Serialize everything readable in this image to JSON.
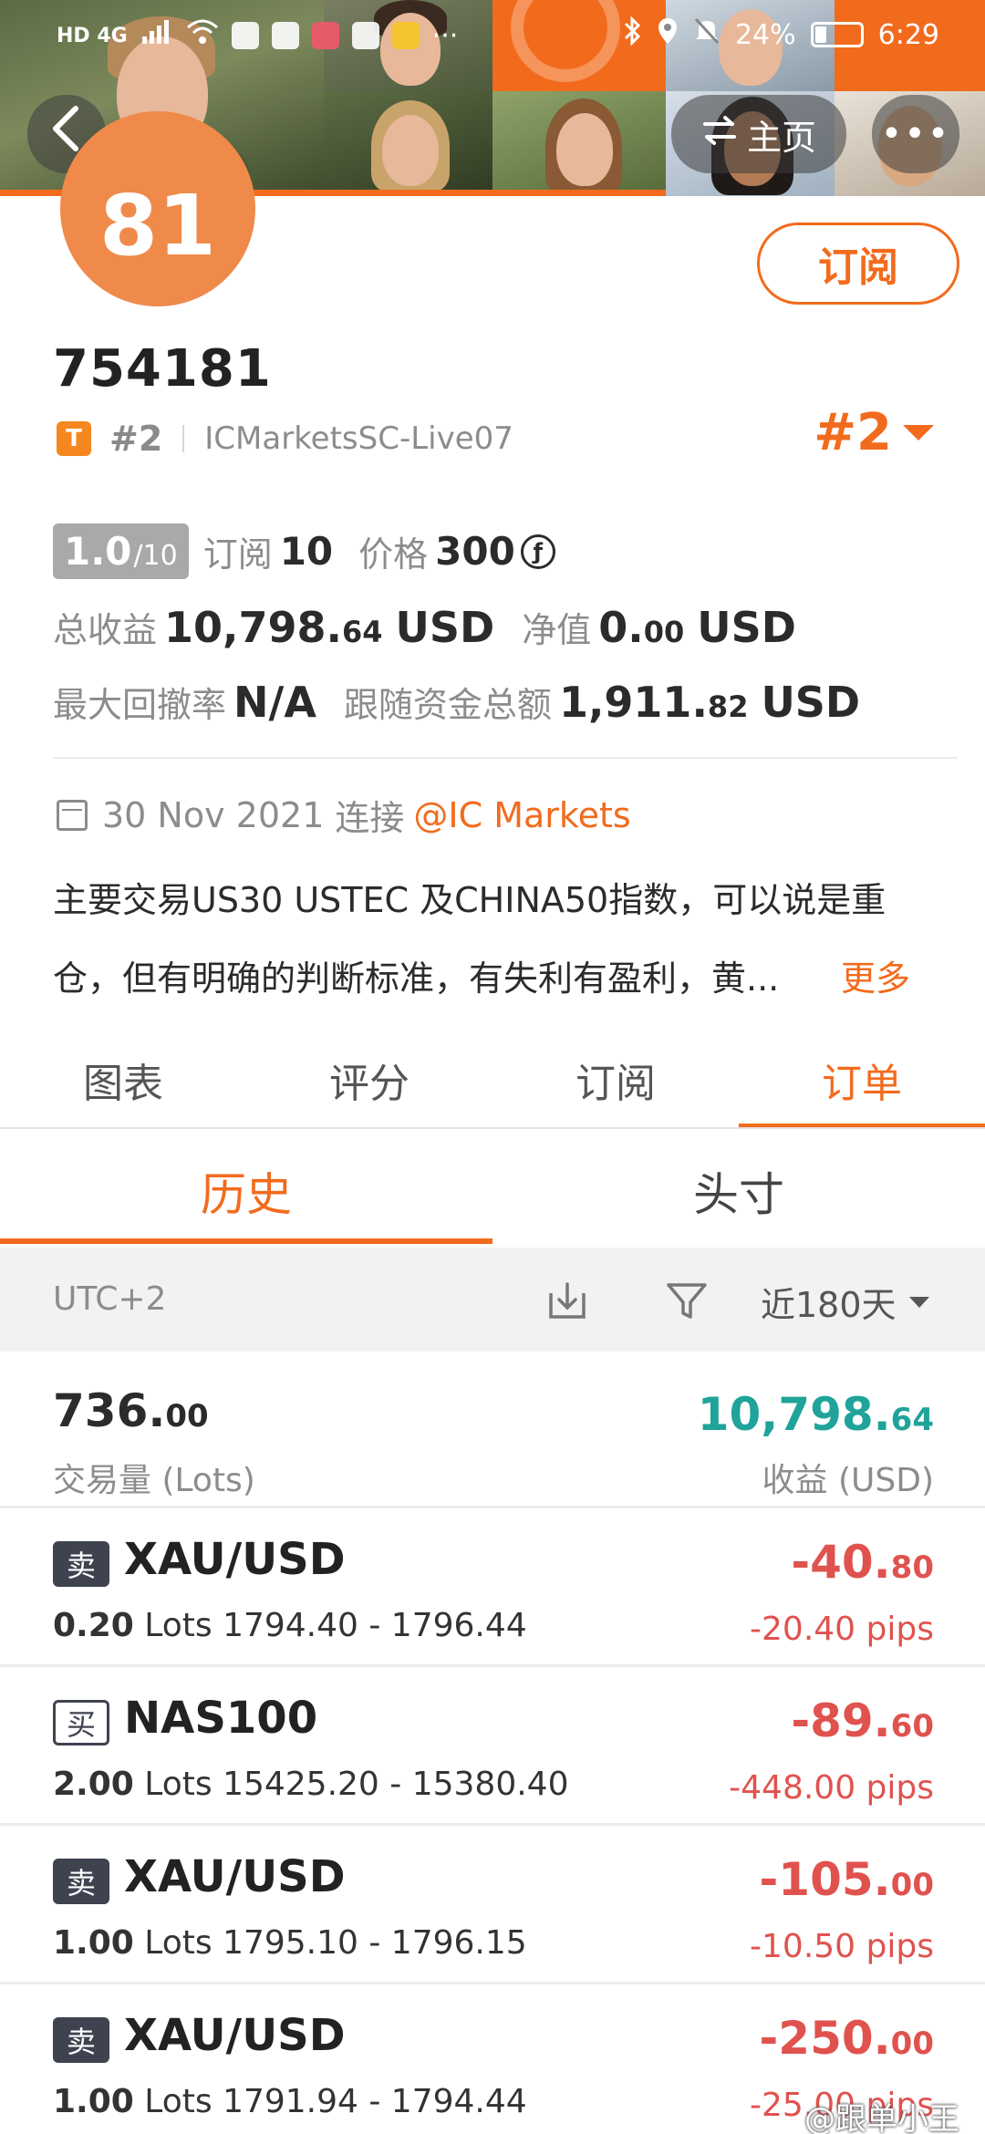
{
  "status_bar": {
    "left": "HD 4G",
    "battery": "24%",
    "time": "6:29"
  },
  "nav": {
    "back_icon": "chevron-left-icon",
    "home_label": "主页",
    "home_icon": "swap-icon",
    "more_label": "•••"
  },
  "profile": {
    "avatar_text": "81",
    "subscribe_label": "订阅",
    "account_id": "754181",
    "tier_badge": "T",
    "rank_small": "#2",
    "server": "ICMarketsSC-Live07",
    "rank_big": "#2"
  },
  "stats": {
    "score": "1.0",
    "score_max": "/10",
    "subscriptions_label": "订阅",
    "subscriptions_value": "10",
    "price_label": "价格",
    "price_value": "300",
    "total_profit_label": "总收益",
    "total_profit_int": "10,798.",
    "total_profit_dec": "64",
    "total_profit_unit": "USD",
    "equity_label": "净值",
    "equity_int": "0.",
    "equity_dec": "00",
    "equity_unit": "USD",
    "max_drawdown_label": "最大回撤率",
    "max_drawdown_value": "N/A",
    "follow_funds_label": "跟随资金总额",
    "follow_funds_int": "1,911.",
    "follow_funds_dec": "82",
    "follow_funds_unit": "USD"
  },
  "info": {
    "date": "30 Nov 2021",
    "connect_label": "连接",
    "broker_link": "@IC Markets",
    "description_line1": "主要交易US30 USTEC 及CHINA50指数，可以说是重",
    "description_line2": "仓，但有明确的判断标准，有失利有盈利，黄...",
    "more_label": "更多"
  },
  "tabs": [
    "图表",
    "评分",
    "订阅",
    "订单"
  ],
  "subtabs": [
    "历史",
    "头寸"
  ],
  "filter": {
    "timezone": "UTC+2",
    "period": "近180天"
  },
  "summary": {
    "lots_int": "736.",
    "lots_dec": "00",
    "lots_label": "交易量 (Lots)",
    "profit_int": "10,798.",
    "profit_dec": "64",
    "profit_label": "收益 (USD)"
  },
  "orders": [
    {
      "side": "卖",
      "symbol": "XAU/USD",
      "lots": "0.20",
      "lots_unit": "Lots",
      "range": "1794.40 - 1796.44",
      "pl_int": "-40.",
      "pl_dec": "80",
      "pips": "-20.40 pips"
    },
    {
      "side": "买",
      "symbol": "NAS100",
      "lots": "2.00",
      "lots_unit": "Lots",
      "range": "15425.20 - 15380.40",
      "pl_int": "-89.",
      "pl_dec": "60",
      "pips": "-448.00 pips"
    },
    {
      "side": "卖",
      "symbol": "XAU/USD",
      "lots": "1.00",
      "lots_unit": "Lots",
      "range": "1795.10 - 1796.15",
      "pl_int": "-105.",
      "pl_dec": "00",
      "pips": "-10.50 pips"
    },
    {
      "side": "卖",
      "symbol": "XAU/USD",
      "lots": "1.00",
      "lots_unit": "Lots",
      "range": "1791.94 - 1794.44",
      "pl_int": "-250.",
      "pl_dec": "00",
      "pips": "-25.00 pips"
    }
  ],
  "watermark": "@跟单小王",
  "colors": {
    "accent": "#f26b1d",
    "profit_green": "#1fa39a",
    "loss_red": "#e0524e",
    "sell_badge": "#3f4350"
  }
}
